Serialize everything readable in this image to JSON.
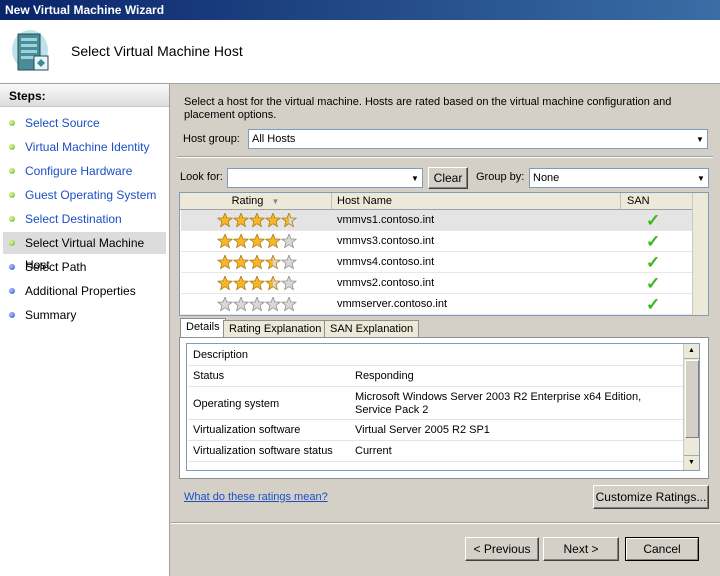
{
  "window": {
    "title": "New Virtual Machine Wizard"
  },
  "header": {
    "title": "Select Virtual Machine Host",
    "icon": "server-wizard-icon"
  },
  "sidebar": {
    "heading": "Steps:",
    "items": [
      {
        "label": "Select Source",
        "state": "done"
      },
      {
        "label": "Virtual Machine Identity",
        "state": "done"
      },
      {
        "label": "Configure Hardware",
        "state": "done"
      },
      {
        "label": "Guest Operating System",
        "state": "done"
      },
      {
        "label": "Select Destination",
        "state": "done"
      },
      {
        "label": "Select Virtual Machine Host",
        "state": "current"
      },
      {
        "label": "Select Path",
        "state": "todo"
      },
      {
        "label": "Additional Properties",
        "state": "todo"
      },
      {
        "label": "Summary",
        "state": "todo"
      }
    ]
  },
  "main": {
    "intro": "Select a host for the virtual machine. Hosts are rated based on the virtual machine configuration and placement options.",
    "host_group_label": "Host group:",
    "host_group_value": "All Hosts",
    "look_for_label": "Look for:",
    "look_for_value": "",
    "clear_label": "Clear",
    "group_by_label": "Group by:",
    "group_by_value": "None",
    "grid": {
      "columns": [
        "Rating",
        "Host Name",
        "SAN"
      ],
      "rows": [
        {
          "rating": 4.5,
          "host": "vmmvs1.contoso.int",
          "san": true
        },
        {
          "rating": 4,
          "host": "vmmvs3.contoso.int",
          "san": true
        },
        {
          "rating": 3.5,
          "host": "vmmvs4.contoso.int",
          "san": true
        },
        {
          "rating": 3.5,
          "host": "vmmvs2.contoso.int",
          "san": true
        },
        {
          "rating": 0,
          "host": "vmmserver.contoso.int",
          "san": true
        }
      ]
    },
    "tabs": [
      "Details",
      "Rating Explanation",
      "SAN Explanation"
    ],
    "details": [
      {
        "key": "Description",
        "value": ""
      },
      {
        "key": "Status",
        "value": "Responding"
      },
      {
        "key": "Operating system",
        "value": "Microsoft Windows Server 2003 R2 Enterprise x64 Edition, Service Pack 2"
      },
      {
        "key": "Virtualization software",
        "value": "Virtual Server 2005 R2 SP1"
      },
      {
        "key": "Virtualization software status",
        "value": "Current"
      }
    ],
    "ratings_link": "What do these ratings mean?",
    "customize_label": "Customize Ratings..."
  },
  "footer": {
    "previous_label": "< Previous",
    "next_label": "Next >",
    "cancel_label": "Cancel"
  },
  "colors": {
    "title_start": "#0a246a",
    "title_end": "#3a6ea5",
    "link": "#1c4fc4",
    "step_done": "#5cb81c",
    "step_todo": "#2a4fd0",
    "check": "#3ab81c",
    "star": "#f5b82a"
  }
}
